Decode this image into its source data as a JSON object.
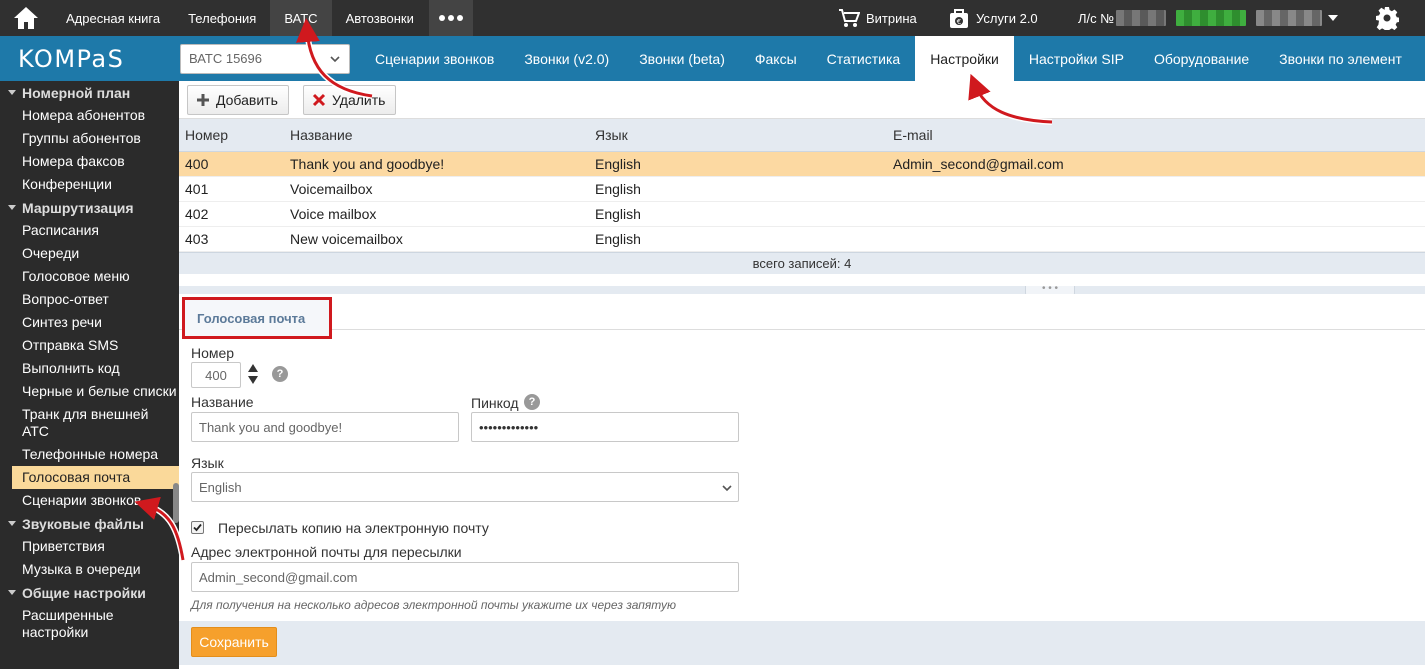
{
  "topbar": {
    "home_icon": "home-icon",
    "items": [
      "Адресная книга",
      "Телефония",
      "ВАТС",
      "Автозвонки"
    ],
    "active_item": "ВАТС",
    "more_icon": "more-dots-icon",
    "store_label": "Витрина",
    "services_label": "Услуги 2.0",
    "account_prefix": "Л/с №",
    "settings_icon": "gear-icon",
    "colors": {
      "bg": "#303030",
      "active": "#444444",
      "account_green": "#3fae3f"
    }
  },
  "navbar": {
    "logo": "KOMPaS",
    "vats_select": "ВАТС 15696",
    "tabs": [
      "Сценарии звонков",
      "Звонки (v2.0)",
      "Звонки (beta)",
      "Факсы",
      "Статистика",
      "Настройки",
      "Настройки SIP",
      "Оборудование",
      "Звонки по элемент"
    ],
    "active_tab": "Настройки",
    "colors": {
      "bg": "#1e79a9"
    }
  },
  "sidebar": {
    "groups": [
      {
        "title": "Номерной план",
        "items": [
          "Номера абонентов",
          "Группы абонентов",
          "Номера факсов",
          "Конференции"
        ]
      },
      {
        "title": "Маршрутизация",
        "items": [
          "Расписания",
          "Очереди",
          "Голосовое меню",
          "Вопрос-ответ",
          "Синтез речи",
          "Отправка SMS",
          "Выполнить код",
          "Черные и белые списки",
          "Транк для внешней АТС",
          "Телефонные номера",
          "Голосовая почта",
          "Сценарии звонков"
        ]
      },
      {
        "title": "Звуковые файлы",
        "items": [
          "Приветствия",
          "Музыка в очереди"
        ]
      },
      {
        "title": "Общие настройки",
        "items": [
          "Расширенные настройки"
        ]
      }
    ],
    "active_item": "Голосовая почта"
  },
  "toolbar": {
    "add_label": "Добавить",
    "add_icon": "plus-icon",
    "delete_label": "Удалить",
    "delete_icon": "x-icon"
  },
  "grid": {
    "columns": [
      "Номер",
      "Название",
      "Язык",
      "E-mail"
    ],
    "rows": [
      [
        "400",
        "Thank you and goodbye!",
        "English",
        "Admin_second@gmail.com"
      ],
      [
        "401",
        "Voicemailbox",
        "English",
        ""
      ],
      [
        "402",
        "Voice mailbox",
        "English",
        ""
      ],
      [
        "403",
        "New voicemailbox",
        "English",
        ""
      ]
    ],
    "selected_row": 0,
    "footer": "всего записей: 4"
  },
  "form": {
    "tab_label": "Голосовая почта",
    "number_label": "Номер",
    "number_value": "400",
    "name_label": "Название",
    "name_value": "Thank you and goodbye!",
    "pin_label": "Пинкод",
    "pin_value": "•••••••••••••",
    "language_label": "Язык",
    "language_value": "English",
    "forward_label": "Пересылать копию на электронную почту",
    "forward_checked": true,
    "email_label": "Адрес электронной почты для пересылки",
    "email_value": "Admin_second@gmail.com",
    "hint": "Для получения на несколько адресов электронной почты укажите их через запятую",
    "save_label": "Сохранить",
    "colors": {
      "save": "#f6a02c",
      "highlight": "#d0191e",
      "selected_row": "#fcd9a2"
    }
  }
}
